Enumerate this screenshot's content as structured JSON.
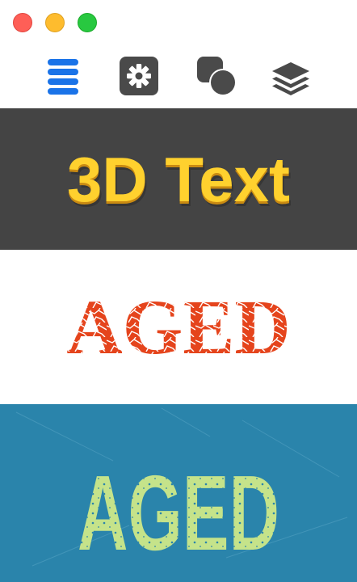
{
  "window": {
    "controls": [
      "close",
      "minimize",
      "zoom"
    ]
  },
  "toolbar": {
    "items": [
      {
        "icon": "menu-icon"
      },
      {
        "icon": "gear-icon"
      },
      {
        "icon": "shapes-icon"
      },
      {
        "icon": "layers-icon"
      }
    ],
    "colors": {
      "accent": "#1a73e8",
      "dark": "#4a4a4a"
    }
  },
  "previews": [
    {
      "text": "3D Text",
      "background": "#444444",
      "fill": "#ffd12e",
      "shade": "#c98a12"
    },
    {
      "text": "AGED",
      "background": "#ffffff",
      "fill": "#e5441c",
      "shade": "#a72d10"
    },
    {
      "text": "AGED",
      "background": "#2a84ab",
      "fill": "#c5e38a",
      "shade": "#9bbf62"
    }
  ]
}
